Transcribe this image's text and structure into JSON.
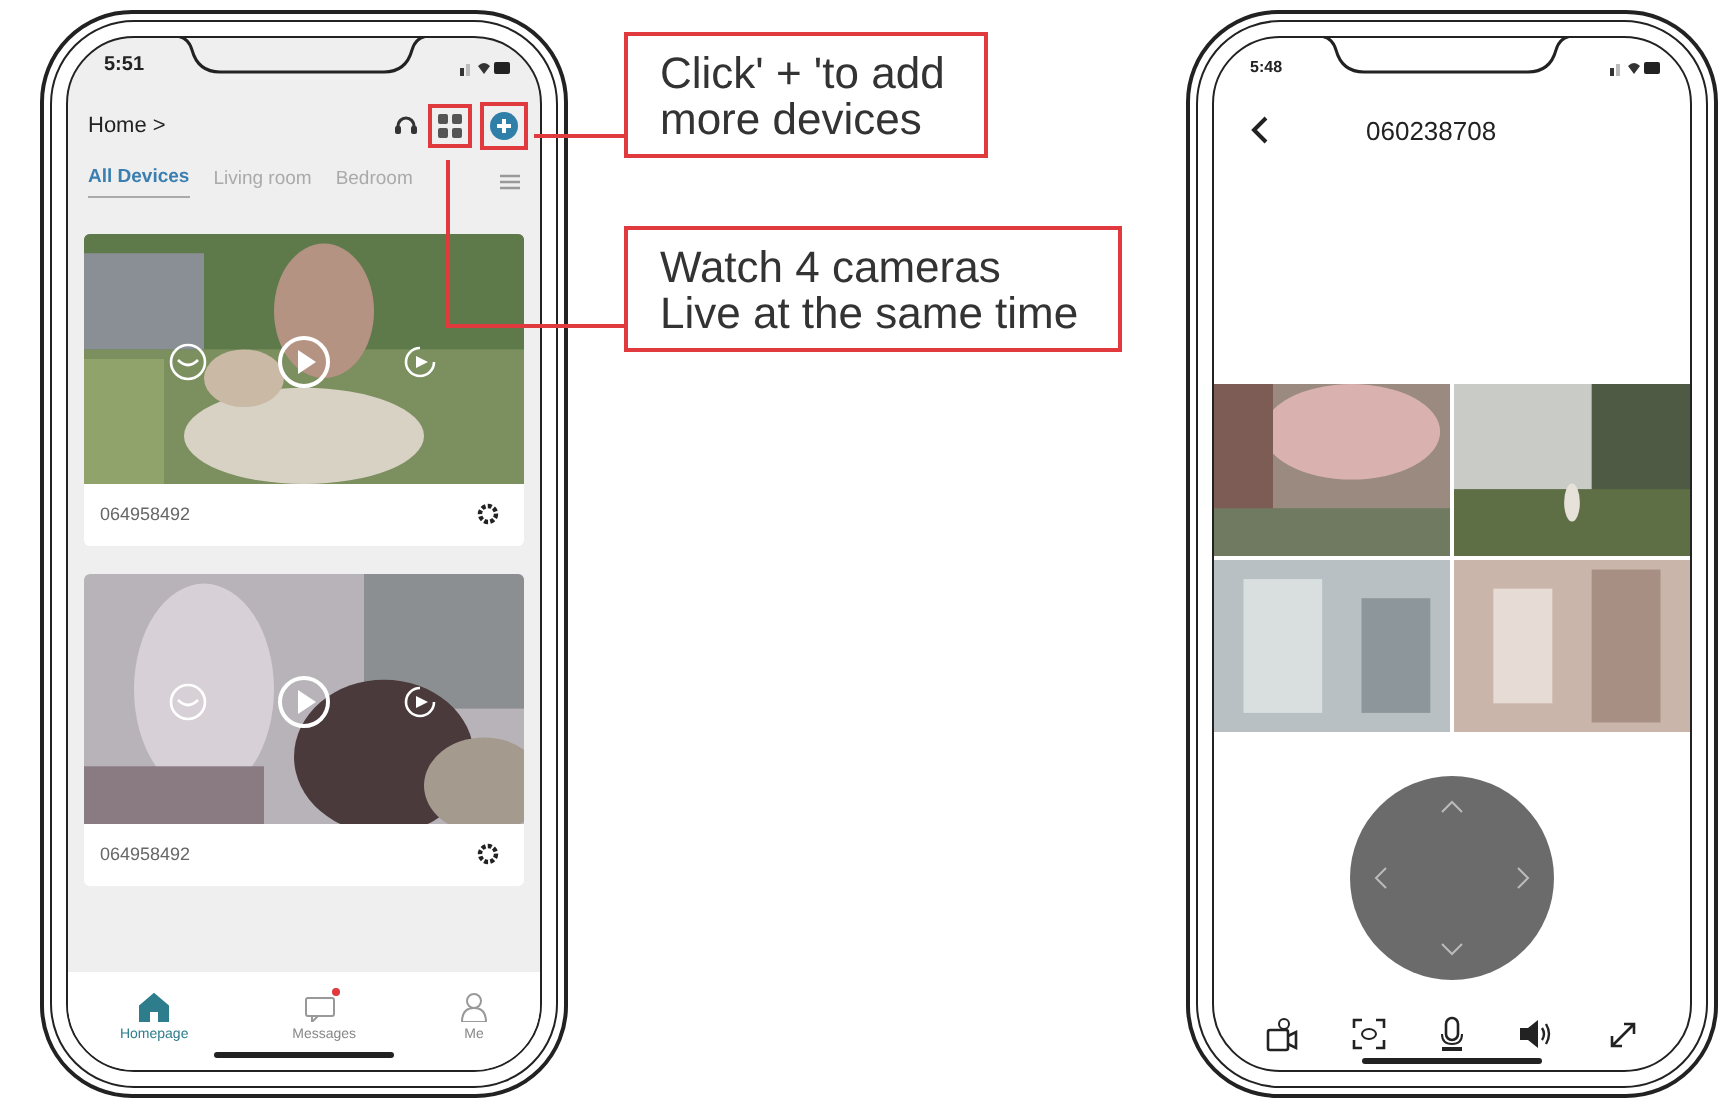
{
  "home_screen": {
    "status_time": "5:51",
    "title": "Home >",
    "tabs": [
      {
        "label": "All Devices",
        "selected": true
      },
      {
        "label": "Living room",
        "selected": false
      },
      {
        "label": "Bedroom",
        "selected": false
      }
    ],
    "devices": [
      {
        "name": "064958492"
      },
      {
        "name": "064958492"
      }
    ],
    "nav": [
      {
        "label": "Homepage",
        "selected": true,
        "badge": false
      },
      {
        "label": "Messages",
        "selected": false,
        "badge": true
      },
      {
        "label": "Me",
        "selected": false,
        "badge": false
      }
    ]
  },
  "callouts": [
    {
      "text": "Click' + 'to add\nmore devices"
    },
    {
      "text": "Watch 4 cameras\nLive at the same time"
    }
  ],
  "live_screen": {
    "status_time": "5:48",
    "title": "060238708"
  }
}
